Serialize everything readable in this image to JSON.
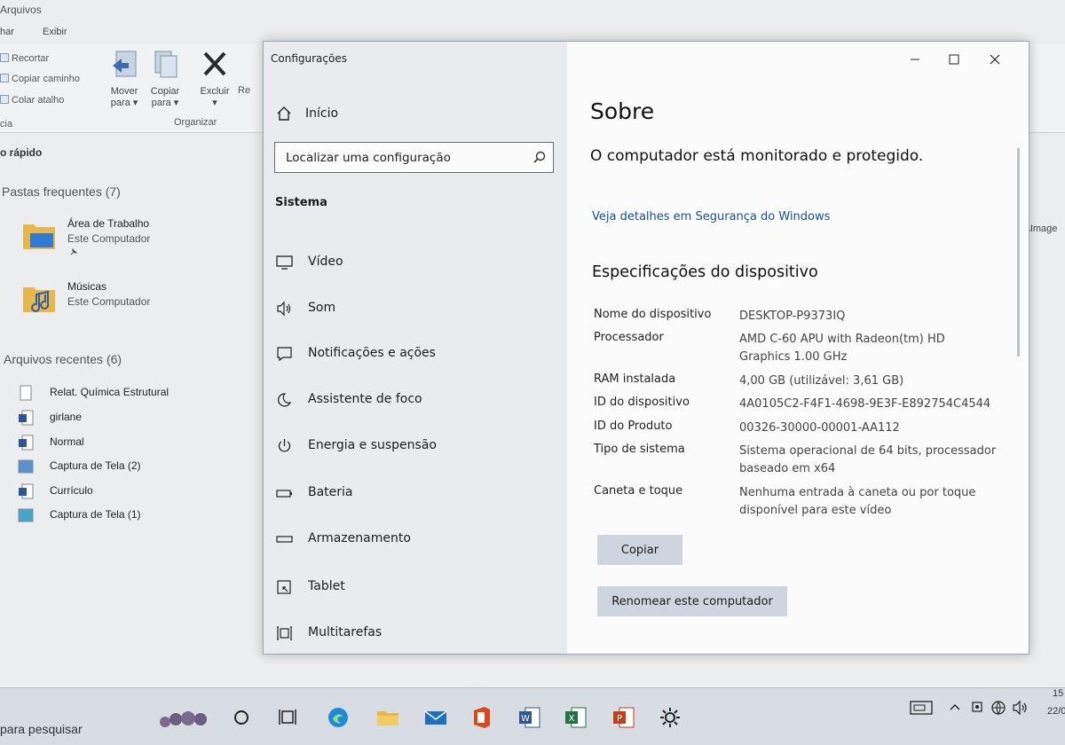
{
  "explorer": {
    "title": "Arquivos",
    "menu": [
      "har",
      "Exibir"
    ],
    "ribbon": {
      "cut": "Recortar",
      "copy_path": "Copiar caminho",
      "paste_shortcut": "Colar atalho",
      "clipboard_group": "cia",
      "move_to_line1": "Mover",
      "move_to_line2": "para ▾",
      "copy_to_line1": "Copiar",
      "copy_to_line2": "para ▾",
      "delete_label": "Excluir",
      "delete_arrow": "▾",
      "rename_partial": "Re",
      "organize_group": "Organizar"
    },
    "nav_label": "o rápido",
    "frequent_header": "Pastas frequentes (7)",
    "frequent": [
      {
        "name": "Área de Trabalho",
        "sub": "Este Computador"
      },
      {
        "name": "Músicas",
        "sub": "Este Computador"
      }
    ],
    "recent_header": "Arquivos recentes (6)",
    "recent": [
      {
        "name": "Relat. Química Estrutural"
      },
      {
        "name": "girlane"
      },
      {
        "name": "Normal"
      },
      {
        "name": "Captura de Tela (2)"
      },
      {
        "name": "Currículo"
      },
      {
        "name": "Captura de Tela (1)"
      }
    ],
    "right_path": "or\\Image"
  },
  "settings": {
    "window_title": "Configurações",
    "home_label": "Início",
    "search_placeholder": "Localizar uma configuração",
    "section_heading": "Sistema",
    "nav": [
      {
        "label": "Vídeo",
        "icon": "monitor-icon"
      },
      {
        "label": "Som",
        "icon": "speaker-icon"
      },
      {
        "label": "Notificações e ações",
        "icon": "notification-icon"
      },
      {
        "label": "Assistente de foco",
        "icon": "moon-icon"
      },
      {
        "label": "Energia e suspensão",
        "icon": "power-icon"
      },
      {
        "label": "Bateria",
        "icon": "battery-icon"
      },
      {
        "label": "Armazenamento",
        "icon": "storage-icon"
      },
      {
        "label": "Tablet",
        "icon": "tablet-icon"
      },
      {
        "label": "Multitarefas",
        "icon": "multitask-icon"
      }
    ],
    "content": {
      "title": "Sobre",
      "status": "O computador está monitorado e protegido.",
      "security_link": "Veja detalhes em Segurança do Windows",
      "specs_heading": "Especificações do dispositivo",
      "specs": [
        {
          "key": "Nome do dispositivo",
          "value": "DESKTOP-P9373IQ"
        },
        {
          "key": "Processador",
          "value": "AMD C-60 APU with Radeon(tm) HD Graphics   1.00 GHz"
        },
        {
          "key": "RAM instalada",
          "value": "4,00 GB (utilizável: 3,61 GB)"
        },
        {
          "key": "ID do dispositivo",
          "value": "4A0105C2-F4F1-4698-9E3F-E892754C4544"
        },
        {
          "key": "ID do Produto",
          "value": "00326-30000-00001-AA112"
        },
        {
          "key": "Tipo de sistema",
          "value": "Sistema operacional de 64 bits, processador baseado em x64"
        },
        {
          "key": "Caneta e toque",
          "value": "Nenhuma entrada à caneta ou por toque disponível para este vídeo"
        }
      ],
      "copy_button": "Copiar",
      "rename_button": "Renomear este computador"
    }
  },
  "taskbar": {
    "search_text": "para pesquisar",
    "time": "15",
    "date": "22/0"
  },
  "colors": {
    "link": "#1b4f9a",
    "button_bg": "#cfd5de",
    "sidebar_bg": "#e9ebee"
  }
}
